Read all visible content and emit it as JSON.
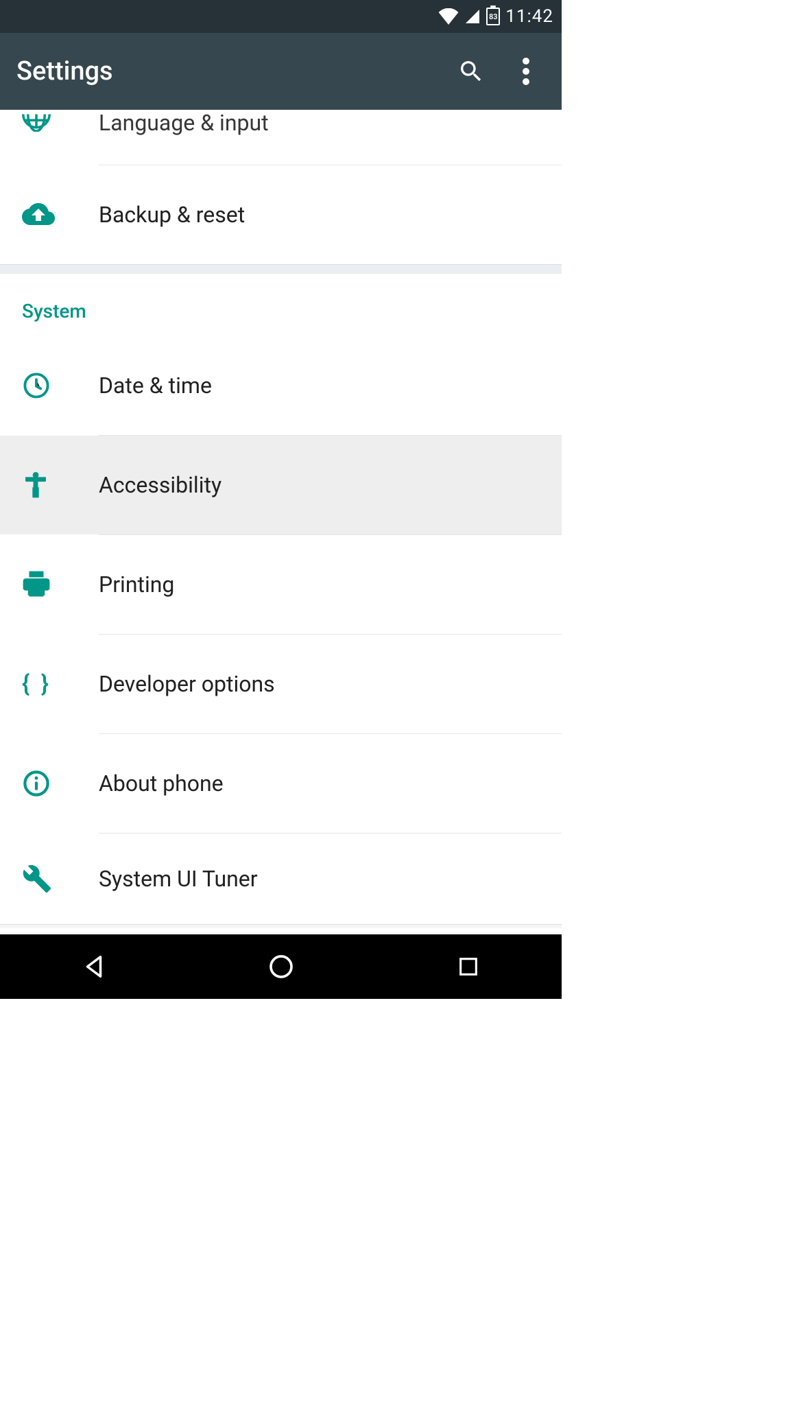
{
  "status": {
    "battery": "83",
    "time": "11:42"
  },
  "header": {
    "title": "Settings"
  },
  "rows": {
    "language": "Language & input",
    "backup": "Backup & reset",
    "section": "System",
    "datetime": "Date & time",
    "accessibility": "Accessibility",
    "printing": "Printing",
    "developer": "Developer options",
    "about": "About phone",
    "tuner": "System UI Tuner"
  }
}
